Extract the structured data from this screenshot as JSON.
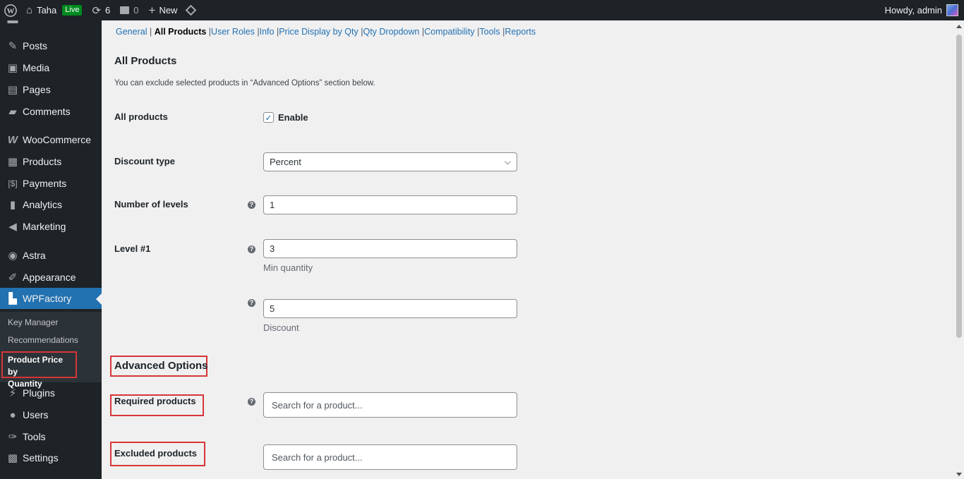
{
  "adminbar": {
    "site_name": "Taha",
    "live_badge": "Live",
    "updates_count": "6",
    "comments_count": "0",
    "new_label": "New",
    "greeting": "Howdy, admin"
  },
  "sidebar": {
    "items": [
      {
        "label": "Posts",
        "icon": "pin-icon"
      },
      {
        "label": "Media",
        "icon": "media-icon"
      },
      {
        "label": "Pages",
        "icon": "pages-icon"
      },
      {
        "label": "Comments",
        "icon": "comment-icon"
      },
      {
        "label": "WooCommerce",
        "icon": "woocommerce-icon"
      },
      {
        "label": "Products",
        "icon": "archive-icon"
      },
      {
        "label": "Payments",
        "icon": "payments-icon"
      },
      {
        "label": "Analytics",
        "icon": "chart-bar-icon"
      },
      {
        "label": "Marketing",
        "icon": "megaphone-icon"
      },
      {
        "label": "Astra",
        "icon": "astra-icon"
      },
      {
        "label": "Appearance",
        "icon": "brush-icon"
      },
      {
        "label": "WPFactory",
        "icon": "wpfactory-icon"
      },
      {
        "label": "Plugins",
        "icon": "plugin-icon"
      },
      {
        "label": "Users",
        "icon": "user-icon"
      },
      {
        "label": "Tools",
        "icon": "wrench-icon"
      },
      {
        "label": "Settings",
        "icon": "settings-icon"
      }
    ],
    "submenu": {
      "key_manager": "Key Manager",
      "recommendations": "Recommendations",
      "current_line1": "Product Price by",
      "current_line2": "Quantity"
    }
  },
  "tabs": {
    "general": "General",
    "all_products": "All Products",
    "user_roles": "User Roles",
    "info": "Info",
    "price_display": "Price Display by Qty",
    "qty_dropdown": "Qty Dropdown",
    "compatibility": "Compatibility",
    "tools": "Tools",
    "reports": "Reports"
  },
  "section": {
    "title": "All Products",
    "description": "You can exclude selected products in “Advanced Options” section below."
  },
  "form": {
    "all_products_label": "All products",
    "enable_label": "Enable",
    "enable_checked": true,
    "discount_type_label": "Discount type",
    "discount_type_value": "Percent",
    "levels_label": "Number of levels",
    "levels_value": "1",
    "level1_label": "Level #1",
    "min_qty_value": "3",
    "min_qty_sublabel": "Min quantity",
    "discount_value": "5",
    "discount_sublabel": "Discount"
  },
  "advanced": {
    "title": "Advanced Options",
    "required_label": "Required products",
    "required_placeholder": "Search for a product...",
    "excluded_label": "Excluded products",
    "excluded_placeholder": "Search for a product..."
  },
  "colors": {
    "admin_dark": "#1d2327",
    "accent_blue": "#2271b1",
    "highlight_red": "#d63638",
    "live_green": "#008a20"
  }
}
